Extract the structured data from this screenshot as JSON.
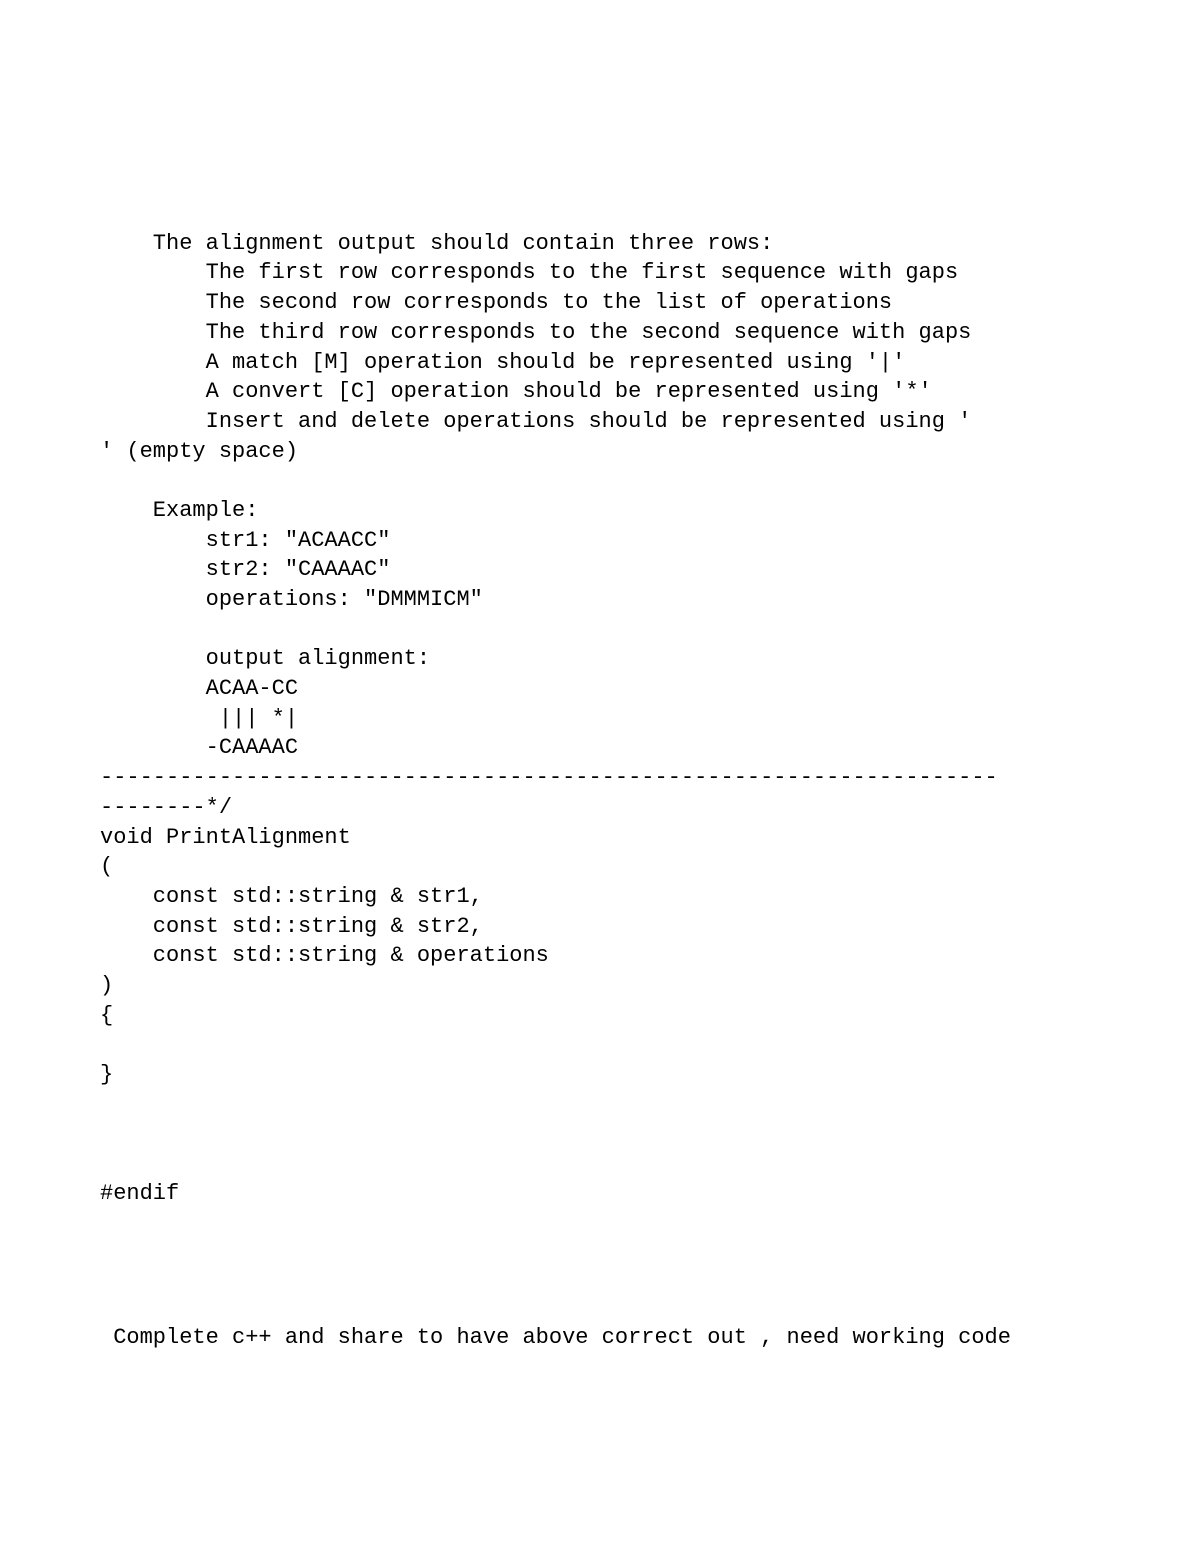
{
  "code": {
    "lines": [
      "    The alignment output should contain three rows:",
      "        The first row corresponds to the first sequence with gaps",
      "        The second row corresponds to the list of operations",
      "        The third row corresponds to the second sequence with gaps",
      "        A match [M] operation should be represented using '|'",
      "        A convert [C] operation should be represented using '*'",
      "        Insert and delete operations should be represented using '",
      "' (empty space)",
      "",
      "    Example:",
      "        str1: \"ACAACC\"",
      "        str2: \"CAAAAC\"",
      "        operations: \"DMMMICM\"",
      "",
      "        output alignment:",
      "        ACAA-CC",
      "         ||| *|",
      "        -CAAAAC",
      "--------------------------------------------------------------------",
      "--------*/",
      "void PrintAlignment",
      "(",
      "    const std::string & str1,",
      "    const std::string & str2,",
      "    const std::string & operations",
      ")",
      "{",
      "",
      "}",
      "",
      "",
      "",
      "#endif"
    ]
  },
  "request": " Complete c++ and share to have above correct out , need working code"
}
